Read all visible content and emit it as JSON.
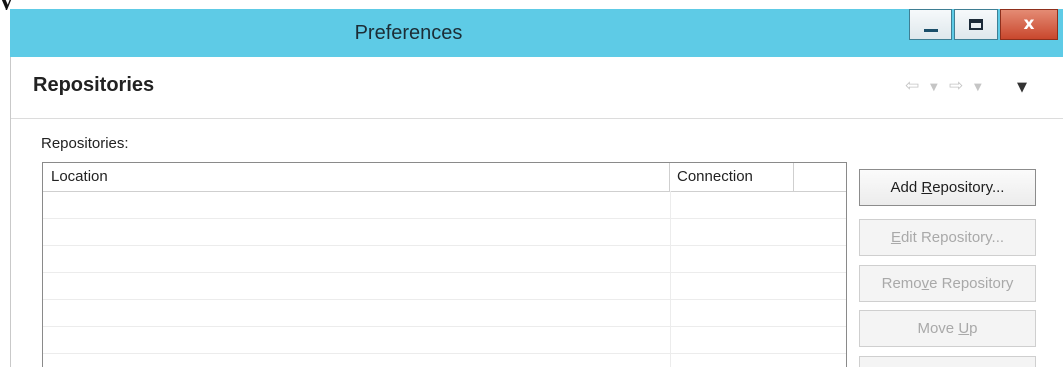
{
  "window": {
    "title": "Preferences",
    "close_glyph": "x"
  },
  "colors": {
    "titlebar": "#5ecbe6",
    "close_button": "#c9472d"
  },
  "page": {
    "title": "Repositories",
    "nav_icons": [
      "back-arrow-icon",
      "dropdown-icon",
      "forward-arrow-icon",
      "dropdown-icon",
      "view-menu-icon"
    ]
  },
  "repositories": {
    "label": "Repositories:",
    "columns": [
      "Location",
      "Connection",
      ""
    ],
    "rows": []
  },
  "buttons": [
    {
      "pre": "Add ",
      "mnemonic": "R",
      "post": "epository...",
      "enabled": true
    },
    {
      "pre": "",
      "mnemonic": "E",
      "post": "dit Repository...",
      "enabled": false
    },
    {
      "pre": "Remo",
      "mnemonic": "v",
      "post": "e Repository",
      "enabled": false
    },
    {
      "pre": "Move ",
      "mnemonic": "U",
      "post": "p",
      "enabled": false
    },
    {
      "pre": "",
      "mnemonic": "",
      "post": "",
      "enabled": false
    }
  ]
}
